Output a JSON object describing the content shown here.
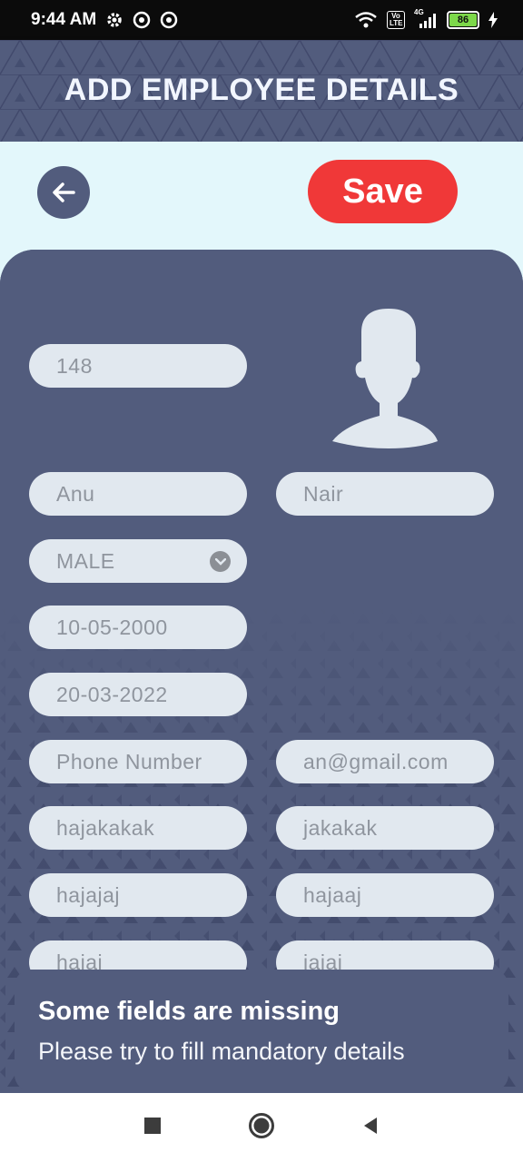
{
  "status_bar": {
    "time": "9:44 AM",
    "battery": "86",
    "network": "4G",
    "volte": "Vo LTE"
  },
  "header": {
    "title": "ADD EMPLOYEE DETAILS"
  },
  "toolbar": {
    "save_label": "Save",
    "back_icon": "arrow-left-icon"
  },
  "form": {
    "employee_id": "148",
    "first_name": "Anu",
    "last_name": "Nair",
    "gender": "MALE",
    "dob": "10-05-2000",
    "join_date": "20-03-2022",
    "phone_placeholder": "Phone Number",
    "email": "an@gmail.com",
    "field_a": "hajakakak",
    "field_b": "jakakak",
    "field_c": "hajajaj",
    "field_d": "hajaaj",
    "field_e": "hajaj",
    "field_f": "jajaj"
  },
  "snackbar": {
    "title": "Some fields are missing",
    "message": "Please try to fill mandatory details"
  },
  "colors": {
    "primary": "#525c7d",
    "accent": "#f03838",
    "background": "#e3f7fb",
    "field": "#e1e8ef"
  }
}
